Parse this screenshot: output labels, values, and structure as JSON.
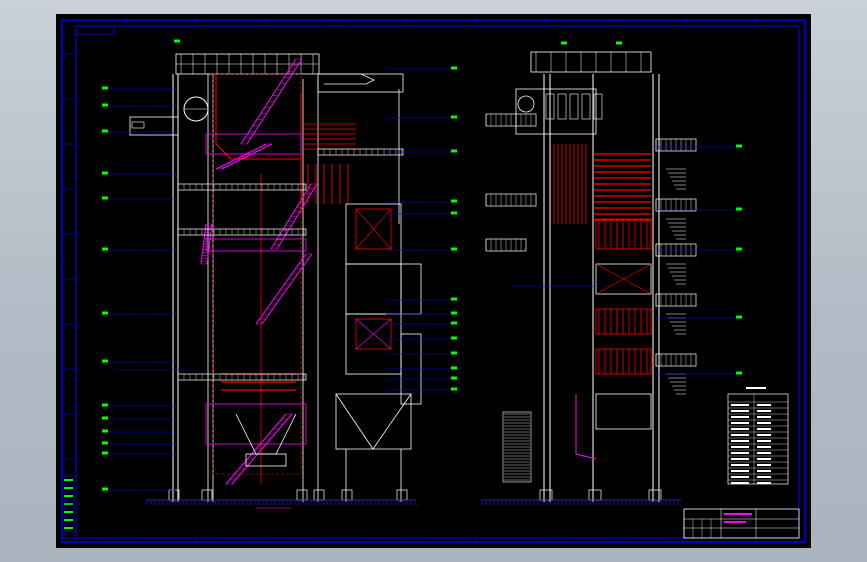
{
  "viewport": {
    "background_gradient": [
      "#c9d0d8",
      "#a9b3be"
    ],
    "sheet_background": "#000000"
  },
  "colors": {
    "frame": "#0000ff",
    "structure_white": "#ffffff",
    "piping_red": "#ff0000",
    "steel_magenta": "#ff00ff",
    "leader_blue": "#0000ff",
    "label_green": "#00ff00",
    "hatch_blue": "#3333ff"
  },
  "drawing": {
    "type": "boiler elevation drawing (CAD)",
    "views": [
      "front-elevation",
      "side-elevation"
    ],
    "title_block": "",
    "parts_table_header": "",
    "notes": ""
  }
}
